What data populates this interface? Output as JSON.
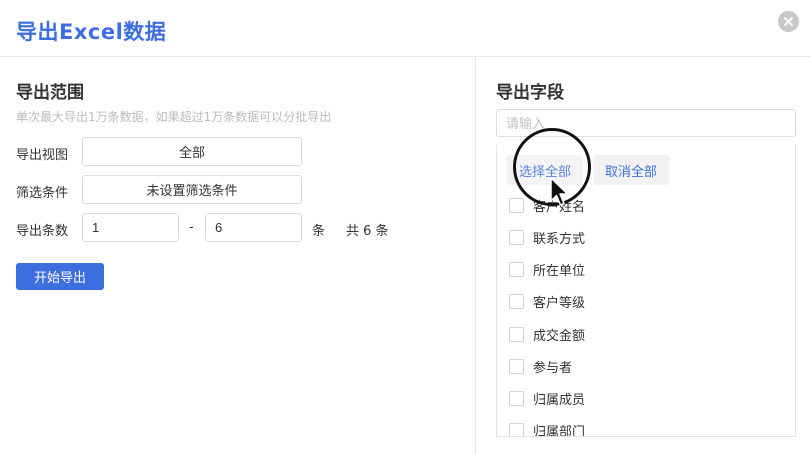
{
  "dialog": {
    "title": "导出Excel数据"
  },
  "export_range": {
    "title": "导出范围",
    "hint": "单次最大导出1万条数据，如果超过1万条数据可以分批导出",
    "view_label": "导出视图",
    "view_value": "全部",
    "filter_label": "筛选条件",
    "filter_value": "未设置筛选条件",
    "count_label": "导出条数",
    "count_from": "1",
    "dash": "-",
    "count_to": "6",
    "unit": "条",
    "total": "共 6 条",
    "start_button": "开始导出"
  },
  "export_fields": {
    "title": "导出字段",
    "search_placeholder": "请输入",
    "select_all": "选择全部",
    "deselect_all": "取消全部",
    "items": [
      {
        "label": "客户姓名",
        "checked": false
      },
      {
        "label": "联系方式",
        "checked": false
      },
      {
        "label": "所在单位",
        "checked": false
      },
      {
        "label": "客户等级",
        "checked": false
      },
      {
        "label": "成交金额",
        "checked": false
      },
      {
        "label": "参与者",
        "checked": false
      },
      {
        "label": "归属成员",
        "checked": false
      },
      {
        "label": "归属部门",
        "checked": false
      }
    ]
  },
  "colors": {
    "accent": "#3d6ee0",
    "hint": "#bbbbbb",
    "border": "#dcdcdc"
  },
  "icons": {
    "close": "close-icon",
    "cursor": "mouse-pointer-icon"
  }
}
